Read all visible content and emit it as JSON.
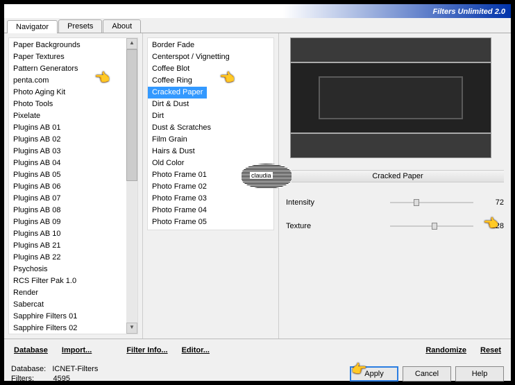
{
  "title": "Filters Unlimited 2.0",
  "tabs": [
    "Navigator",
    "Presets",
    "About"
  ],
  "categories": [
    "Paper Backgrounds",
    "Paper Textures",
    "Pattern Generators",
    "penta.com",
    "Photo Aging Kit",
    "Photo Tools",
    "Pixelate",
    "Plugins AB 01",
    "Plugins AB 02",
    "Plugins AB 03",
    "Plugins AB 04",
    "Plugins AB 05",
    "Plugins AB 06",
    "Plugins AB 07",
    "Plugins AB 08",
    "Plugins AB 09",
    "Plugins AB 10",
    "Plugins AB 21",
    "Plugins AB 22",
    "Psychosis",
    "RCS Filter Pak 1.0",
    "Render",
    "Sabercat",
    "Sapphire Filters 01",
    "Sapphire Filters 02"
  ],
  "filters": [
    "Border Fade",
    "Centerspot / Vignetting",
    "Coffee Blot",
    "Coffee Ring",
    "Cracked Paper",
    "Dirt & Dust",
    "Dirt",
    "Dust & Scratches",
    "Film Grain",
    "Hairs & Dust",
    "Old Color",
    "Photo Frame 01",
    "Photo Frame 02",
    "Photo Frame 03",
    "Photo Frame 04",
    "Photo Frame 05"
  ],
  "selected_filter": "Cracked Paper",
  "current_filter_label": "Cracked Paper",
  "param_intensity_label": "Intensity",
  "param_intensity_value": "72",
  "param_texture_label": "Texture",
  "param_texture_value": "128",
  "bottom_links": {
    "database": "Database",
    "import": "Import...",
    "filterinfo": "Filter Info...",
    "editor": "Editor...",
    "randomize": "Randomize",
    "reset": "Reset"
  },
  "status_db_label": "Database:",
  "status_db_value": "ICNET-Filters",
  "status_filters_label": "Filters:",
  "status_filters_value": "4595",
  "btn_apply": "Apply",
  "btn_cancel": "Cancel",
  "btn_help": "Help"
}
